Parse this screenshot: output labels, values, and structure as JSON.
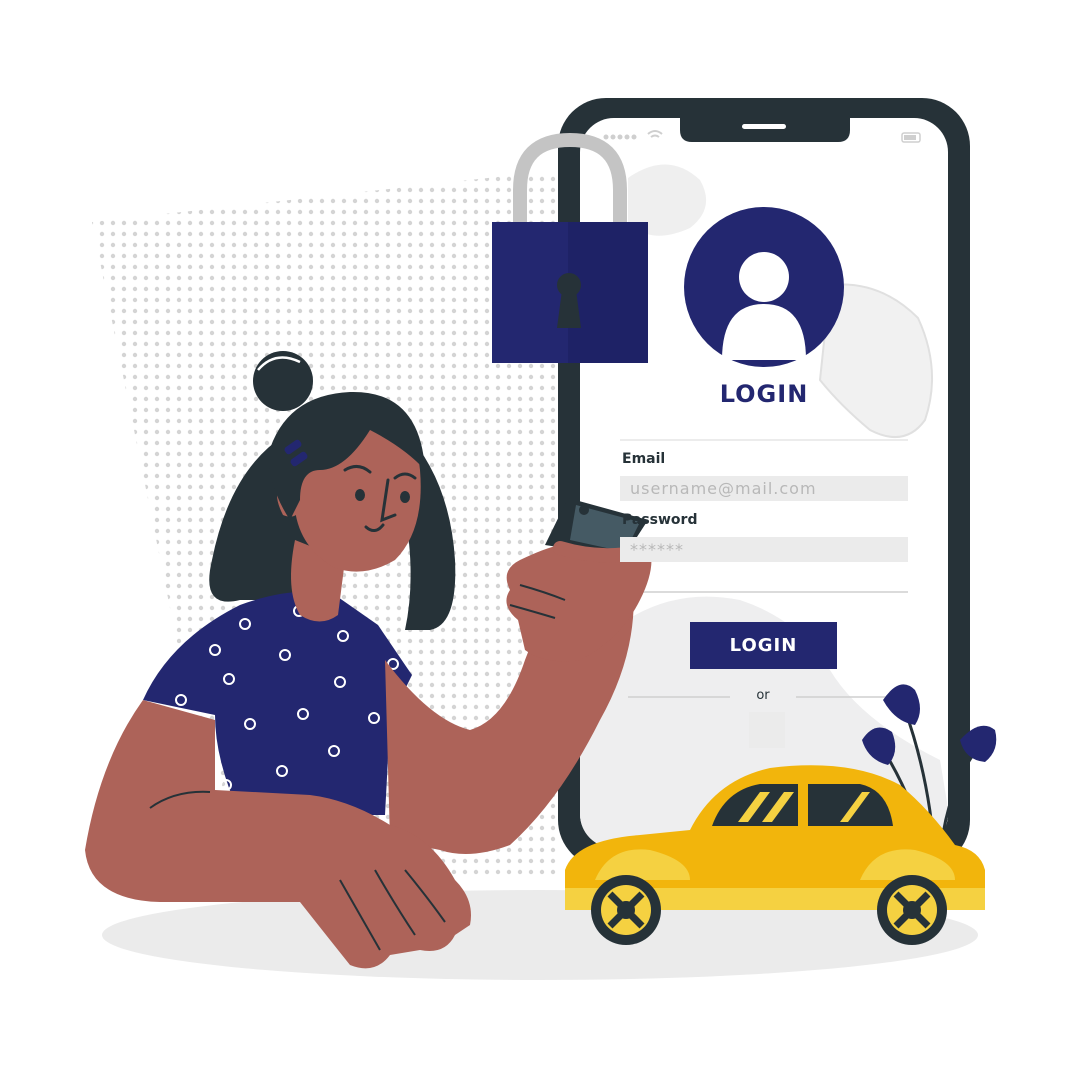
{
  "app": {
    "title": "LOGIN",
    "avatar_icon": "user-icon",
    "lock_icon": "padlock-icon",
    "signal_icon": "signal-dots-icon",
    "wifi_icon": "wifi-icon",
    "battery_icon": "battery-icon"
  },
  "form": {
    "email_label": "Email",
    "email_placeholder": "username@mail.com",
    "password_label": "Password",
    "password_placeholder": "******",
    "login_button": "LOGIN",
    "divider_text": "or"
  },
  "colors": {
    "accent": "#232770",
    "phone_frame": "#263238",
    "skin": "#ad6359",
    "car_yellow": "#f2b50c",
    "field_bg": "#ebebeb"
  }
}
